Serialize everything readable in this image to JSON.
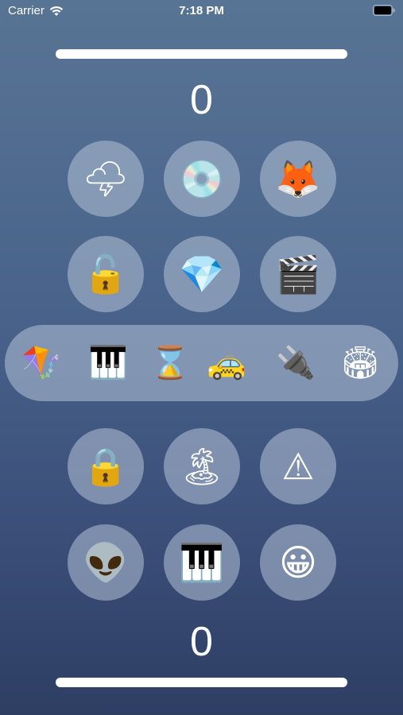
{
  "status": {
    "carrier": "Carrier",
    "time": "7:18 PM"
  },
  "scores": {
    "top": "0",
    "bottom": "0"
  },
  "top_grid": [
    {
      "emoji": "🌩",
      "name": "cloud-lightning-icon"
    },
    {
      "emoji": "💿",
      "name": "cd-disc-icon"
    },
    {
      "emoji": "🦊",
      "name": "fox-icon"
    },
    {
      "emoji": "🔓",
      "name": "open-lock-icon"
    },
    {
      "emoji": "💎",
      "name": "diamond-icon"
    },
    {
      "emoji": "🎬",
      "name": "clapper-board-icon"
    }
  ],
  "middle_row": [
    {
      "emoji": "🪁",
      "name": "kite-icon"
    },
    {
      "emoji": "🎹",
      "name": "piano-keys-icon"
    },
    {
      "emoji": "⌛",
      "name": "hourglass-icon"
    },
    {
      "emoji": "🚕",
      "name": "taxi-icon"
    },
    {
      "emoji": "🔌",
      "name": "plug-icon"
    },
    {
      "emoji": "🏟",
      "name": "stadium-icon"
    }
  ],
  "bottom_grid": [
    {
      "emoji": "🔒",
      "name": "lock-icon"
    },
    {
      "emoji": "🏝",
      "name": "island-icon"
    },
    {
      "emoji": "⚠",
      "name": "warning-icon"
    },
    {
      "emoji": "👽",
      "name": "alien-icon"
    },
    {
      "emoji": "🎹",
      "name": "piano-icon"
    },
    {
      "emoji": "😀",
      "name": "grinning-face-icon"
    }
  ]
}
